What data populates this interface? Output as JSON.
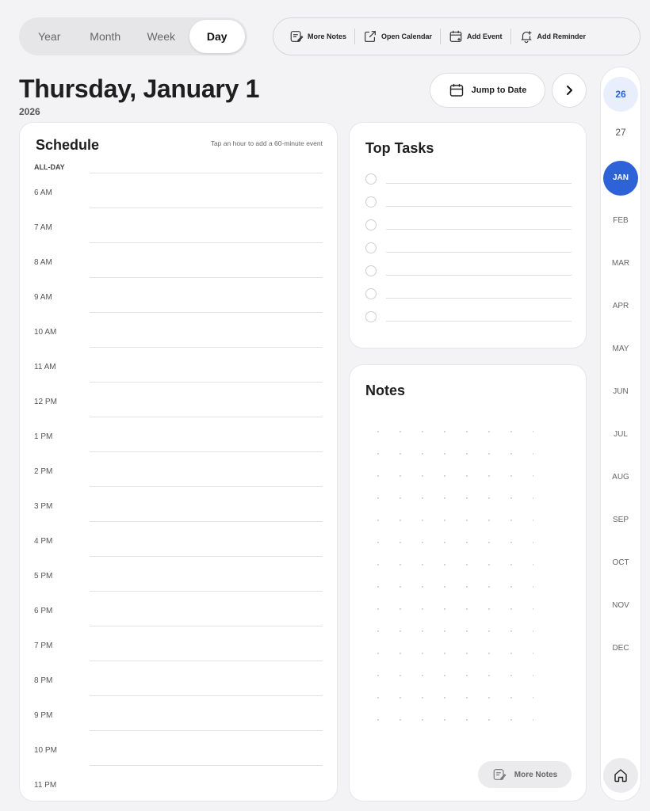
{
  "view_switcher": {
    "options": [
      "Year",
      "Month",
      "Week",
      "Day"
    ],
    "selected": "Day"
  },
  "toolbar": {
    "more_notes": "More Notes",
    "open_calendar": "Open Calendar",
    "add_event": "Add Event",
    "add_reminder": "Add Reminder"
  },
  "header": {
    "title": "Thursday, January 1",
    "year": "2026",
    "jump_to_date": "Jump to Date"
  },
  "schedule": {
    "title": "Schedule",
    "hint": "Tap an hour to add a 60-minute event",
    "all_day_label": "ALL-DAY",
    "hours": [
      "6 AM",
      "7 AM",
      "8 AM",
      "9 AM",
      "10 AM",
      "11 AM",
      "12 PM",
      "1 PM",
      "2 PM",
      "3 PM",
      "4 PM",
      "5 PM",
      "6 PM",
      "7 PM",
      "8 PM",
      "9 PM",
      "10 PM",
      "11 PM"
    ]
  },
  "top_tasks": {
    "title": "Top Tasks",
    "task_count_visible": 7
  },
  "notes": {
    "title": "Notes",
    "more_notes_button": "More Notes"
  },
  "rail": {
    "years": [
      {
        "label": "26",
        "selected": true
      },
      {
        "label": "27",
        "selected": false
      }
    ],
    "months": [
      "JAN",
      "FEB",
      "MAR",
      "APR",
      "MAY",
      "JUN",
      "JUL",
      "AUG",
      "SEP",
      "OCT",
      "NOV",
      "DEC"
    ],
    "selected_month": "JAN"
  },
  "colors": {
    "accent": "#2d63d7",
    "accent_light": "#e8eefb",
    "background": "#f3f3f5"
  },
  "icons": {
    "more_notes": "note-pencil-icon",
    "open_calendar": "external-link-icon",
    "add_event": "calendar-plus-icon",
    "add_reminder": "bell-plus-icon",
    "jump_to_date": "calendar-icon",
    "next": "chevron-right-icon",
    "home": "home-icon"
  }
}
